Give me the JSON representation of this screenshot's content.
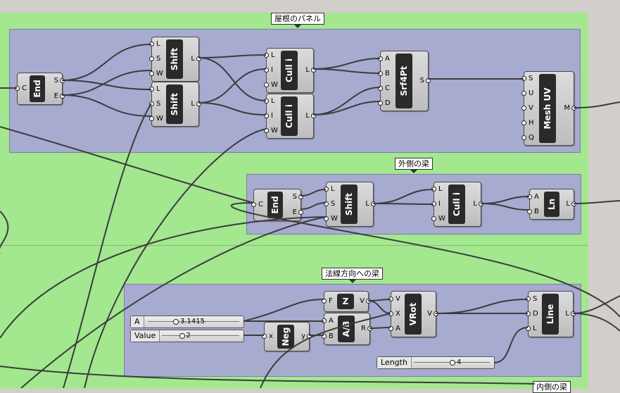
{
  "groups": {
    "roof": "屋根のパネル",
    "outer": "外側の梁",
    "normal": "法線方向への梁"
  },
  "components": {
    "end1": {
      "name": "End",
      "in": [
        "C"
      ],
      "out": [
        "S",
        "E"
      ]
    },
    "shift1": {
      "name": "Shift",
      "in": [
        "L",
        "S",
        "W"
      ],
      "out": [
        "L"
      ]
    },
    "shift2": {
      "name": "Shift",
      "in": [
        "L",
        "S",
        "W"
      ],
      "out": [
        "L"
      ]
    },
    "cull1": {
      "name": "Cull i",
      "in": [
        "L",
        "I",
        "W"
      ],
      "out": [
        "L"
      ]
    },
    "cull2": {
      "name": "Cull i",
      "in": [
        "L",
        "I",
        "W"
      ],
      "out": [
        "L"
      ]
    },
    "srf4pt": {
      "name": "Srf4Pt",
      "in": [
        "A",
        "B",
        "C",
        "D"
      ],
      "out": [
        "S"
      ]
    },
    "meshuv": {
      "name": "Mesh UV",
      "in": [
        "S",
        "U",
        "V",
        "H",
        "Q"
      ],
      "out": [
        "M"
      ]
    },
    "end2": {
      "name": "End",
      "in": [
        "C"
      ],
      "out": [
        "S",
        "E"
      ]
    },
    "shift3": {
      "name": "Shift",
      "in": [
        "L",
        "S",
        "W"
      ],
      "out": [
        "L"
      ]
    },
    "cull3": {
      "name": "Cull i",
      "in": [
        "L",
        "I",
        "W"
      ],
      "out": [
        "L"
      ]
    },
    "ln": {
      "name": "Ln",
      "in": [
        "A",
        "B"
      ],
      "out": [
        "L"
      ]
    },
    "z": {
      "name": "Z",
      "in": [
        "F"
      ],
      "out": [
        "V"
      ]
    },
    "ab": {
      "name": "A/B",
      "in": [
        "A",
        "B"
      ],
      "out": [
        "R"
      ]
    },
    "neg": {
      "name": "Neg",
      "in": [
        "x"
      ],
      "out": [
        "y"
      ]
    },
    "vrot": {
      "name": "VRot",
      "in": [
        "V",
        "X",
        "A"
      ],
      "out": [
        "V"
      ]
    },
    "line": {
      "name": "Line",
      "in": [
        "S",
        "D",
        "L"
      ],
      "out": [
        "L"
      ]
    }
  },
  "sliders": {
    "a": {
      "label": "A",
      "value": "3.1415",
      "fraction": 0.3
    },
    "value": {
      "label": "Value",
      "value": "2",
      "fraction": 0.25
    },
    "length": {
      "label": "Length",
      "value": "4",
      "fraction": 0.5
    }
  },
  "partial_label": "内側の梁"
}
